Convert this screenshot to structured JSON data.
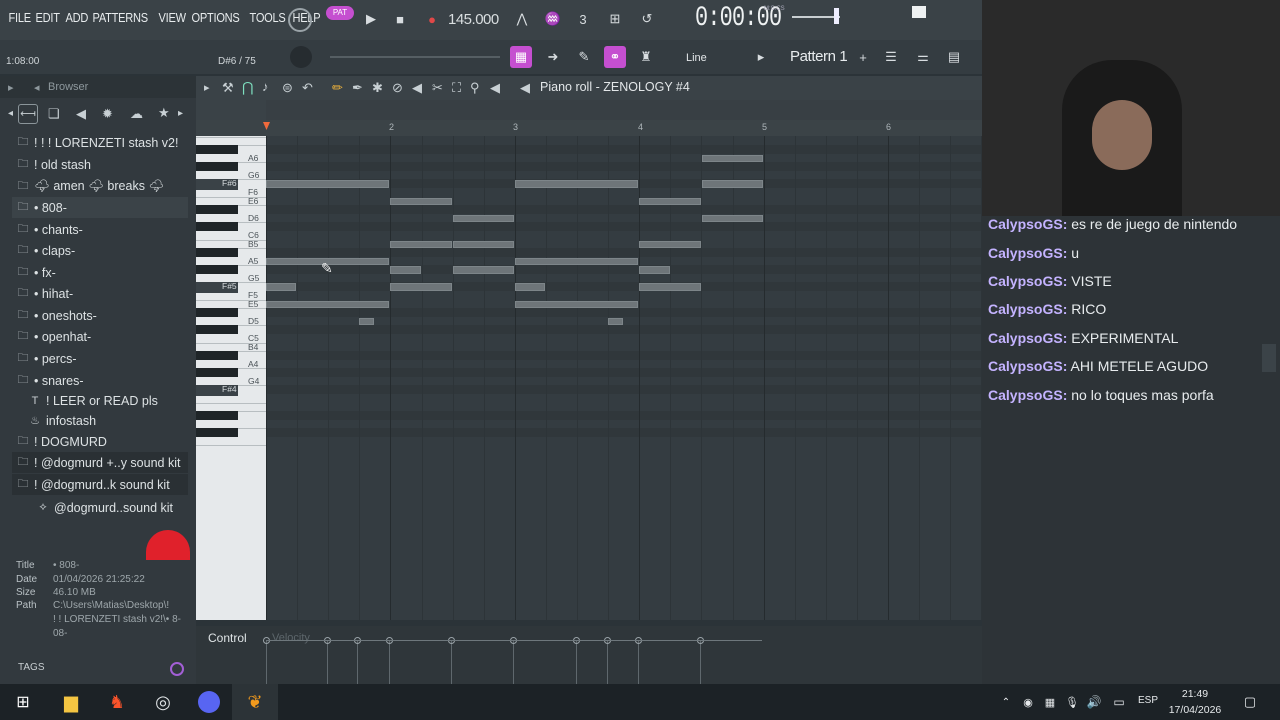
{
  "menu": [
    "FILE",
    "EDIT",
    "ADD",
    "PATTERNS",
    "VIEW",
    "OPTIONS",
    "TOOLS",
    "HELP"
  ],
  "transport": {
    "pat_label": "PAT",
    "bpm": "145.000",
    "time": "0:00:00",
    "time_unit": "M:S:CS",
    "snap": "Line",
    "pattern": "Pattern 1"
  },
  "hint": {
    "left": "1:08:00",
    "right": "D#6 / 75"
  },
  "browser": {
    "title": "Browser",
    "items": [
      {
        "label": "! ! ! LORENZETI stash v2!",
        "icon": "folder-icon"
      },
      {
        "label": "! old stash",
        "icon": "folder-icon"
      },
      {
        "label": "🌩 amen 🌩 breaks 🌩",
        "icon": "folder-icon"
      },
      {
        "label": "• 808-",
        "icon": "folder-icon"
      },
      {
        "label": "• chants-",
        "icon": "folder-icon"
      },
      {
        "label": "• claps-",
        "icon": "folder-icon"
      },
      {
        "label": "• fx-",
        "icon": "folder-icon"
      },
      {
        "label": "• hihat-",
        "icon": "folder-icon"
      },
      {
        "label": "• oneshots-",
        "icon": "folder-icon"
      },
      {
        "label": "• openhat-",
        "icon": "folder-icon"
      },
      {
        "label": "• percs-",
        "icon": "folder-icon"
      },
      {
        "label": "• snares-",
        "icon": "folder-icon"
      },
      {
        "label": "! LEER or READ pls",
        "icon": "text-icon"
      },
      {
        "label": "infostash",
        "icon": "plugin-icon"
      },
      {
        "label": "! DOGMURD",
        "icon": "folder-icon"
      },
      {
        "label": "! @dogmurd +..y sound kit",
        "icon": "folder-icon"
      },
      {
        "label": "! @dogmurd..k sound kit",
        "icon": "folder-icon"
      },
      {
        "label": "@dogmurd..sound kit",
        "icon": "link-icon"
      }
    ],
    "info": {
      "title_label": "Title",
      "title": "• 808-",
      "date_label": "Date",
      "date": "01/04/2026 21:25:22",
      "size_label": "Size",
      "size": "46.10 MB",
      "path_label": "Path",
      "path1": "C:\\Users\\Matias\\Desktop\\!",
      "path2": "! ! LORENZETI stash v2!\\• 8-",
      "path3": "08-"
    },
    "tags": "TAGS"
  },
  "piano_roll": {
    "title": "Piano roll - ZENOLOGY #4",
    "bars": [
      "2",
      "3",
      "4",
      "5",
      "6"
    ],
    "keys": [
      "A6",
      "G6",
      "F#6",
      "F6",
      "E6",
      "D6",
      "C6",
      "B5",
      "A5",
      "G5",
      "F#5",
      "F5",
      "E5",
      "D5",
      "C5",
      "B4",
      "A4",
      "G4",
      "F#4"
    ],
    "control": "Control",
    "velocity": "Velocity"
  },
  "chat": [
    {
      "user": "CalypsoGS:",
      "text": "es re de juego de nintendo"
    },
    {
      "user": "CalypsoGS:",
      "text": "u"
    },
    {
      "user": "CalypsoGS:",
      "text": "VISTE"
    },
    {
      "user": "CalypsoGS:",
      "text": "RICO"
    },
    {
      "user": "CalypsoGS:",
      "text": "EXPERIMENTAL"
    },
    {
      "user": "CalypsoGS:",
      "text": "AHI METELE AGUDO"
    },
    {
      "user": "CalypsoGS:",
      "text": "no lo toques mas porfa"
    }
  ],
  "taskbar": {
    "lang": "ESP",
    "time": "21:49",
    "date": "17/04/2026"
  },
  "colors": {
    "accent": "#c54fd0",
    "note": "#6e7579",
    "chat_user": "#c4b3ff"
  }
}
